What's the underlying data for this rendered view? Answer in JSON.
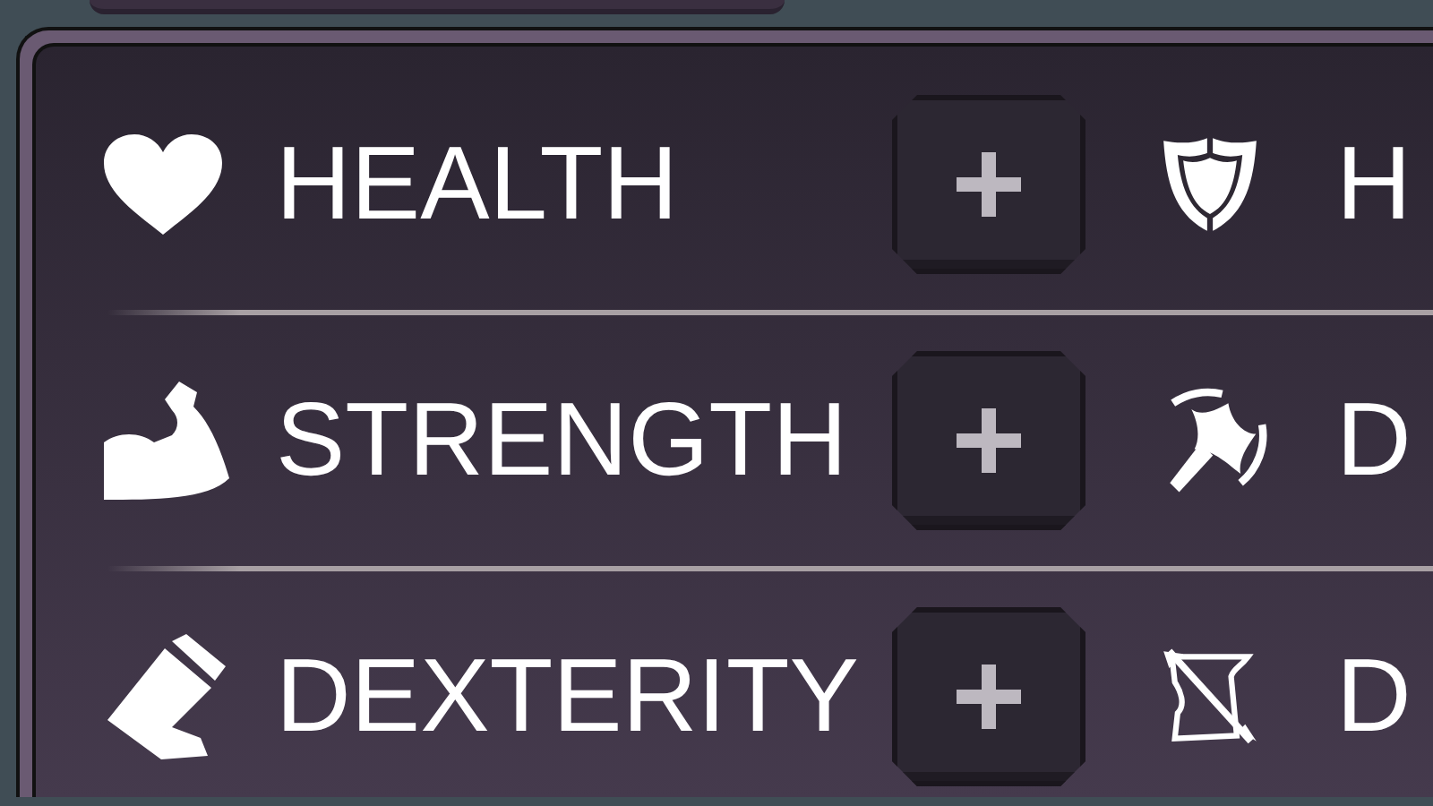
{
  "rows": [
    {
      "stat": {
        "kind": "health",
        "label": "HEALTH"
      },
      "derived": {
        "kind": "shield",
        "label": "H"
      }
    },
    {
      "stat": {
        "kind": "strength",
        "label": "STRENGTH"
      },
      "derived": {
        "kind": "axe",
        "label": "D"
      }
    },
    {
      "stat": {
        "kind": "dexterity",
        "label": "DEXTERITY"
      },
      "derived": {
        "kind": "bow",
        "label": "D"
      }
    }
  ]
}
